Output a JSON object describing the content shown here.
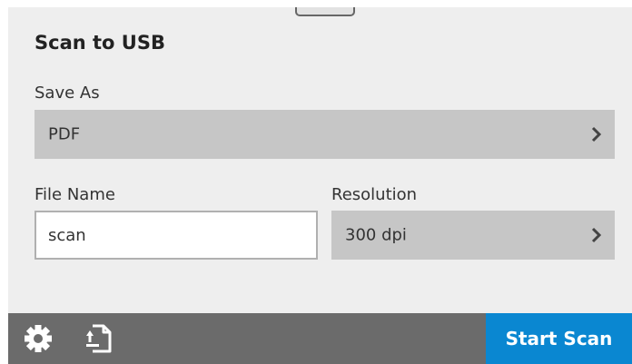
{
  "header": {
    "title": "Scan to USB"
  },
  "save_as": {
    "label": "Save As",
    "value": "PDF",
    "icon": "chevron-right-icon"
  },
  "file_name": {
    "label": "File Name",
    "value": "scan"
  },
  "resolution": {
    "label": "Resolution",
    "value": "300 dpi",
    "icon": "chevron-right-icon"
  },
  "bottom_bar": {
    "settings_icon": "gear-icon",
    "preview_icon": "send-document-icon",
    "start_label": "Start Scan"
  },
  "colors": {
    "accent": "#0a87d1",
    "bar": "#6b6b6b",
    "field": "#c6c6c6",
    "background": "#eeeeee"
  }
}
